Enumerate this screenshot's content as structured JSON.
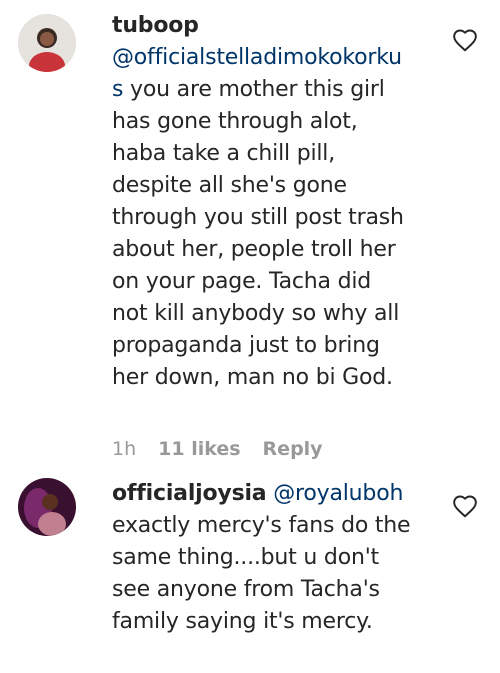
{
  "comments": [
    {
      "username": "tuboop",
      "mention": "@officialstelladimokokorku",
      "mention_wrap": "s",
      "lines": [
        " you are mother this girl",
        "has gone through alot,",
        "haba take a chill pill,",
        "despite all she's gone",
        "through you still post trash",
        "about her, people troll her",
        "on your page. Tacha did",
        "not kill anybody so why all",
        "propaganda just to bring",
        "her down, man no bi God."
      ],
      "time": "1h",
      "likes": "11 likes",
      "reply": "Reply",
      "heart_icon": "heart-outline-icon"
    },
    {
      "username": "officialjoysia",
      "mention": "@royaluboh",
      "lines": [
        "exactly mercy's fans do the",
        "same thing....but u don't",
        "see anyone from Tacha's",
        "family saying it's mercy."
      ],
      "heart_icon": "heart-outline-icon"
    }
  ]
}
